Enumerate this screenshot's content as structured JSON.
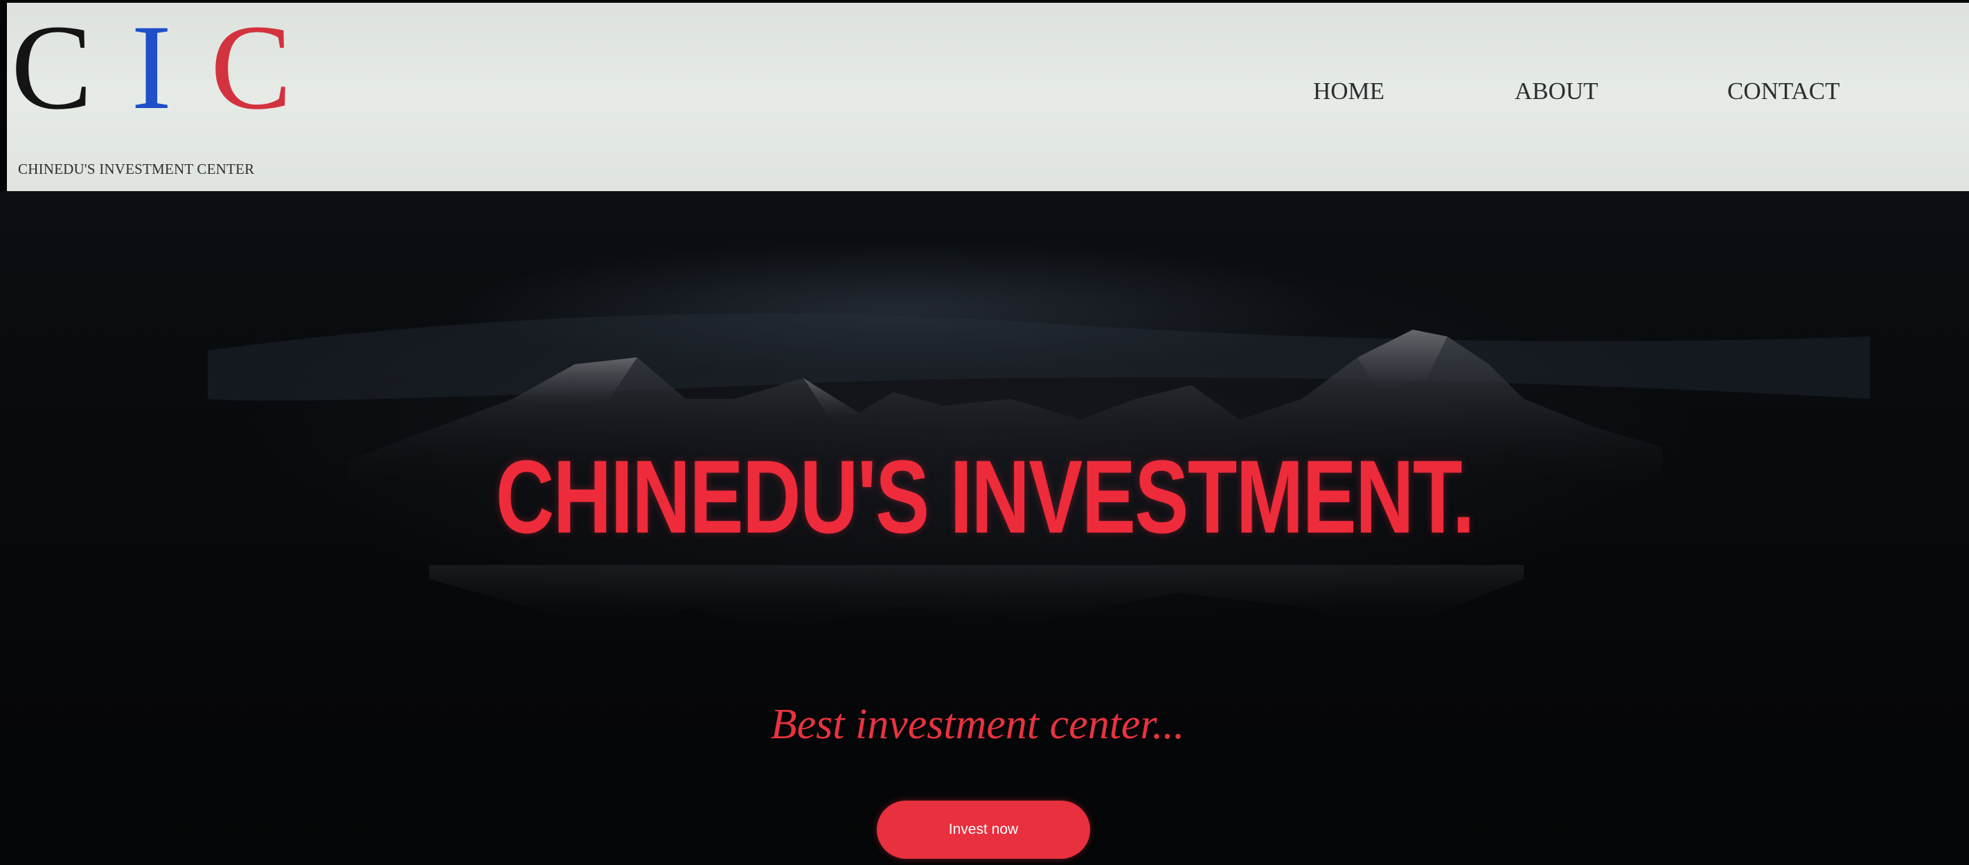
{
  "header": {
    "logo_letters": [
      "C",
      "I",
      "C"
    ],
    "logo_colors": [
      "#141414",
      "#1f4fc9",
      "#d3323f"
    ],
    "logo_subtitle": "CHINEDU'S INVESTMENT CENTER",
    "nav": [
      {
        "label": "HOME"
      },
      {
        "label": "ABOUT"
      },
      {
        "label": "CONTACT"
      }
    ]
  },
  "hero": {
    "background": "dark mountain landscape at night",
    "title": "CHINEDU'S INVESTMENT.",
    "subtitle": "Best investment center...",
    "cta_label": "Invest now",
    "accent_color": "#ee2b3b"
  }
}
